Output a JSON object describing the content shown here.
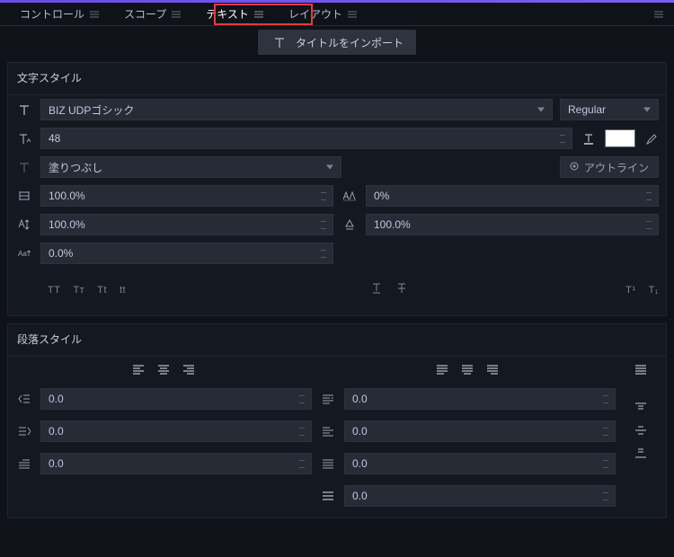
{
  "tabs": {
    "control": "コントロール",
    "scope": "スコープ",
    "text": "テキスト",
    "layout": "レイアウト"
  },
  "import_button": "タイトルをインポート",
  "char_style_title": "文字スタイル",
  "font_family": "BIZ UDPゴシック",
  "font_style": "Regular",
  "font_size": "48",
  "fill_label": "塗りつぶし",
  "outline_label": "アウトライン",
  "spacing": {
    "horizontal": "100.0%",
    "vertical": "100.0%",
    "baseline": "0.0%",
    "tracking": "0%",
    "line_height_pct": "100.0%"
  },
  "case_buttons": [
    "TT",
    "Tᴛ",
    "Tt",
    "tt"
  ],
  "script_buttons": [
    "T¹",
    "T₁"
  ],
  "para_style_title": "段落スタイル",
  "para_values": {
    "left_indent": "0.0",
    "right_indent": "0.0",
    "first_line": "0.0",
    "space_before": "0.0",
    "space_after": "0.0",
    "extra1": "0.0",
    "extra2": "0.0"
  }
}
